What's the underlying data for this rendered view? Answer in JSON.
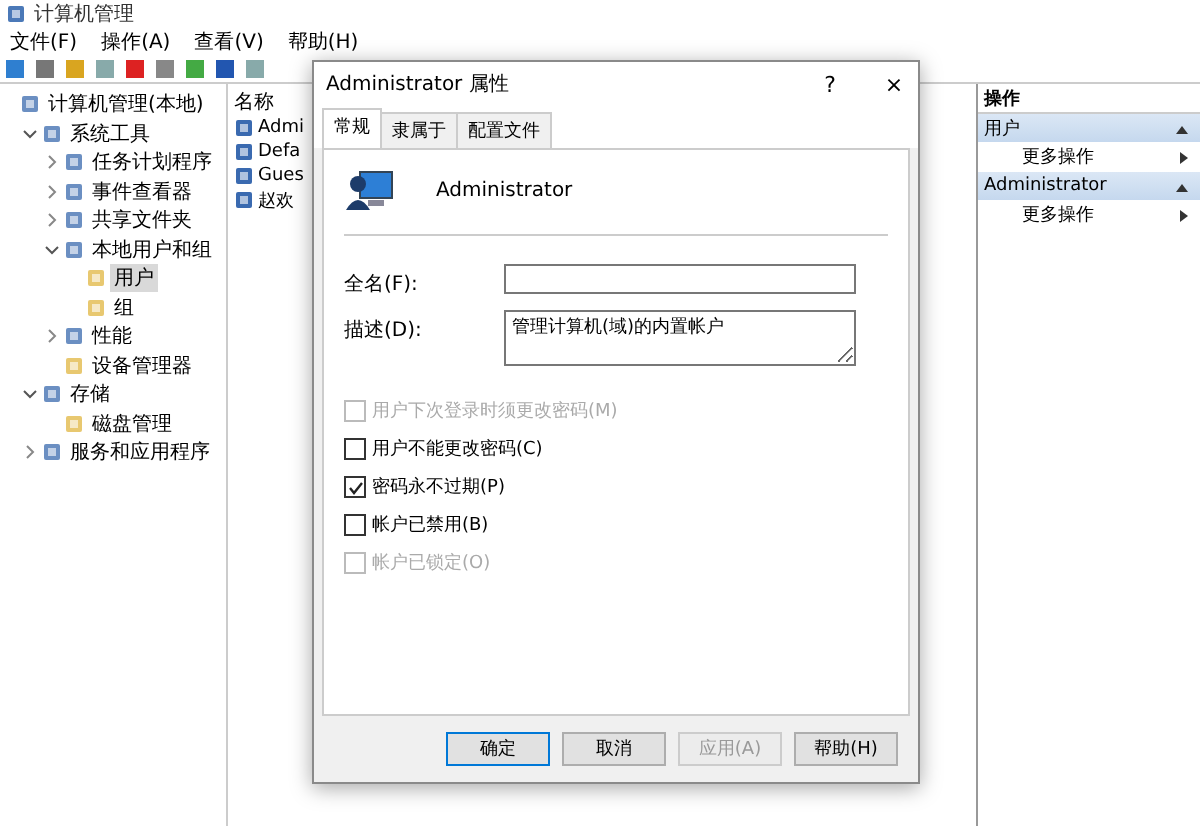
{
  "window": {
    "title": "计算机管理"
  },
  "menu": [
    "文件(F)",
    "操作(A)",
    "查看(V)",
    "帮助(H)"
  ],
  "tree": [
    {
      "label": "计算机管理(本地)",
      "selected": false,
      "children": [
        {
          "label": "系统工具",
          "expanded": true,
          "selected": false,
          "children": [
            {
              "label": "任务计划程序",
              "expanded": false,
              "selected": false
            },
            {
              "label": "事件查看器",
              "expanded": false,
              "selected": false
            },
            {
              "label": "共享文件夹",
              "expanded": false,
              "selected": false
            },
            {
              "label": "本地用户和组",
              "expanded": true,
              "selected": false,
              "children": [
                {
                  "label": "用户",
                  "selected": true
                },
                {
                  "label": "组",
                  "selected": false
                }
              ]
            },
            {
              "label": "性能",
              "expanded": false,
              "selected": false
            },
            {
              "label": "设备管理器",
              "selected": false
            }
          ]
        },
        {
          "label": "存储",
          "expanded": true,
          "selected": false,
          "children": [
            {
              "label": "磁盘管理",
              "selected": false
            }
          ]
        },
        {
          "label": "服务和应用程序",
          "expanded": false,
          "selected": false
        }
      ]
    }
  ],
  "list": {
    "column": "名称",
    "rows": [
      "Admi",
      "Defa",
      "Gues",
      "赵欢"
    ]
  },
  "actions": {
    "title": "操作",
    "sections": [
      {
        "title": "用户",
        "items": [
          "更多操作"
        ]
      },
      {
        "title": "Administrator",
        "items": [
          "更多操作"
        ]
      }
    ]
  },
  "dialog": {
    "title": "Administrator 属性",
    "help": "?",
    "close": "×",
    "tabs": [
      {
        "label": "常规",
        "selected": true
      },
      {
        "label": "隶属于",
        "selected": false
      },
      {
        "label": "配置文件",
        "selected": false
      }
    ],
    "user_name": "Administrator",
    "fields": [
      {
        "label": "全名(F):"
      },
      {
        "label": "描述(D):",
        "value": "管理计算机(域)的内置帐户"
      }
    ],
    "options": [
      {
        "label": "用户下次登录时须更改密码(M)",
        "checked": false,
        "disabled": true
      },
      {
        "label": "用户不能更改密码(C)",
        "checked": false,
        "disabled": false
      },
      {
        "label": "密码永不过期(P)",
        "checked": true,
        "disabled": false
      },
      {
        "label": "帐户已禁用(B)",
        "checked": false,
        "disabled": false
      },
      {
        "label": "帐户已锁定(O)",
        "checked": false,
        "disabled": true
      }
    ],
    "buttons": [
      {
        "label": "确定",
        "kind": "default",
        "disabled": false
      },
      {
        "label": "取消",
        "kind": "normal",
        "disabled": false
      },
      {
        "label": "应用(A)",
        "kind": "normal",
        "disabled": true
      },
      {
        "label": "帮助(H)",
        "kind": "normal",
        "disabled": false
      }
    ]
  }
}
